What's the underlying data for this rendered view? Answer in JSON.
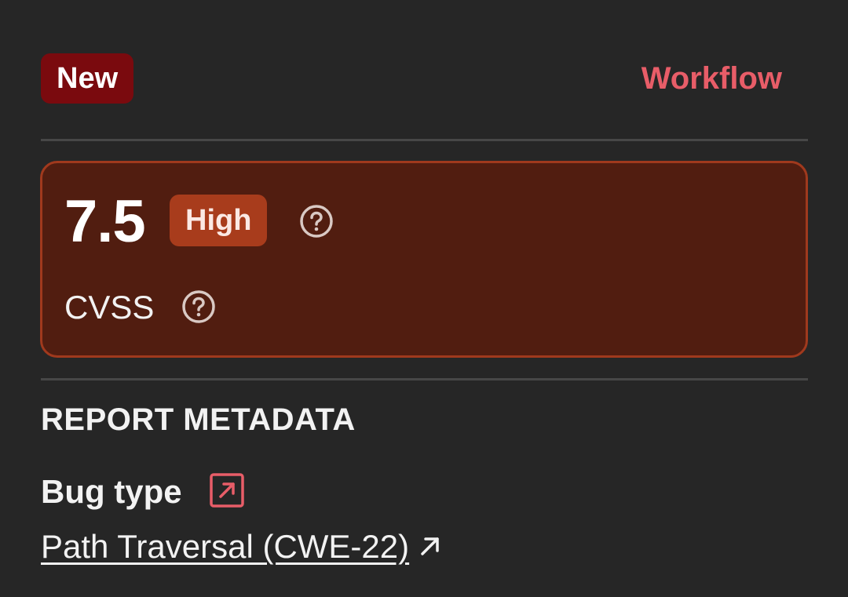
{
  "header": {
    "status_badge": "New",
    "workflow_label": "Workflow"
  },
  "score_card": {
    "score": "7.5",
    "severity": "High",
    "metric_label": "CVSS"
  },
  "metadata": {
    "section_title": "REPORT METADATA",
    "bug_type_label": "Bug type",
    "bug_type_value": "Path Traversal (CWE-22)"
  },
  "icons": {
    "severity_help": "help-circle-icon",
    "cvss_help": "help-circle-icon",
    "bug_type_link": "external-link-box-icon",
    "cwe_link": "arrow-up-right-icon"
  },
  "colors": {
    "background": "#262626",
    "status_badge_bg": "#7a0a0e",
    "accent_link": "#e85d68",
    "card_bg": "#511d10",
    "card_border": "#a0391d",
    "severity_badge_bg": "#a83c1c"
  }
}
